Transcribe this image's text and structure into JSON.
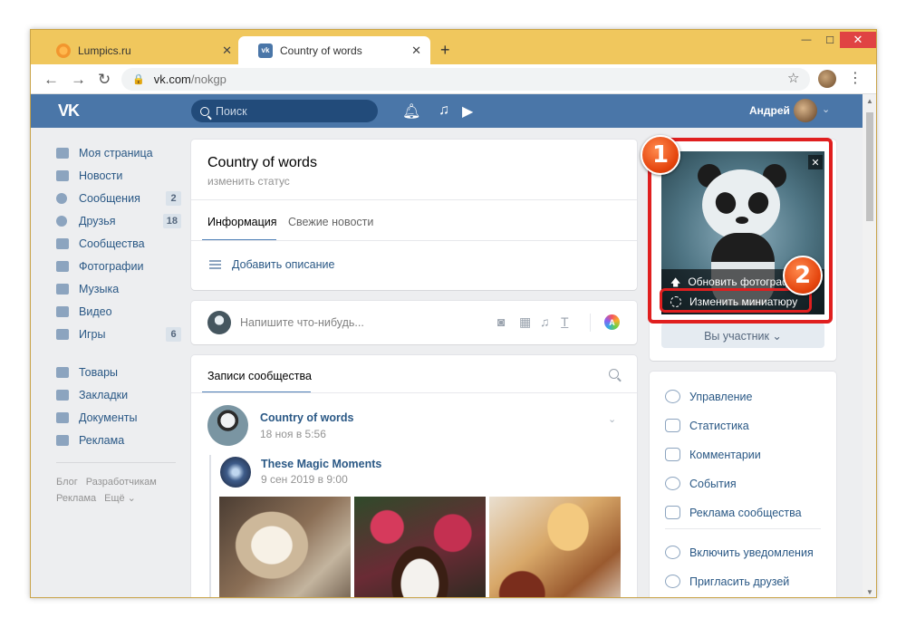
{
  "browser": {
    "tabs": [
      {
        "title": "Lumpics.ru",
        "active": false
      },
      {
        "title": "Country of words",
        "active": true
      }
    ],
    "new_tab": "+",
    "url_host": "vk.com",
    "url_path": "/nokgp",
    "window_buttons": {
      "minimize": "—",
      "maximize": "☐",
      "close": "✕"
    }
  },
  "vk": {
    "logo": "VK",
    "search_placeholder": "Поиск",
    "user_name": "Андрей",
    "left_menu": [
      {
        "label": "Моя страница",
        "badge": ""
      },
      {
        "label": "Новости",
        "badge": ""
      },
      {
        "label": "Сообщения",
        "badge": "2"
      },
      {
        "label": "Друзья",
        "badge": "18"
      },
      {
        "label": "Сообщества",
        "badge": ""
      },
      {
        "label": "Фотографии",
        "badge": ""
      },
      {
        "label": "Музыка",
        "badge": ""
      },
      {
        "label": "Видео",
        "badge": ""
      },
      {
        "label": "Игры",
        "badge": "6"
      }
    ],
    "left_menu_2": [
      {
        "label": "Товары"
      },
      {
        "label": "Закладки"
      },
      {
        "label": "Документы"
      },
      {
        "label": "Реклама"
      }
    ],
    "footer_links": [
      "Блог",
      "Разработчикам",
      "Реклама",
      "Ещё ⌄"
    ],
    "group": {
      "name": "Country of words",
      "status": "изменить статус",
      "tab_info": "Информация",
      "tab_news": "Свежие новости",
      "add_description": "Добавить описание"
    },
    "post_box_placeholder": "Напишите что-нибудь...",
    "post_box_a": "A",
    "wall": {
      "title": "Записи сообщества",
      "post_author": "Country of words",
      "post_date": "18 ноя в 5:56",
      "repost_author": "These Magic Moments",
      "repost_date": "9 сен 2019 в 9:00"
    },
    "cover_menu": {
      "update_photo": "Обновить фотограф",
      "change_thumbnail": "Изменить миниатюру",
      "close": "✕"
    },
    "member_button": "Вы участник ⌄",
    "manage_menu": [
      {
        "label": "Управление",
        "icon": "gear-icon"
      },
      {
        "label": "Статистика",
        "icon": "stats-icon"
      },
      {
        "label": "Комментарии",
        "icon": "comment-icon"
      },
      {
        "label": "События",
        "icon": "event-icon"
      },
      {
        "label": "Реклама сообщества",
        "icon": "megaphone-icon"
      },
      {
        "label": "Включить уведомления",
        "icon": "bell-icon"
      },
      {
        "label": "Пригласить друзей",
        "icon": "add-user-icon"
      }
    ]
  },
  "annotations": {
    "step1": "1",
    "step2": "2",
    "color": "#e01f1f"
  },
  "colors": {
    "vk_blue": "#4a76a8",
    "link": "#2a5885",
    "tabbar": "#f0c75d"
  }
}
